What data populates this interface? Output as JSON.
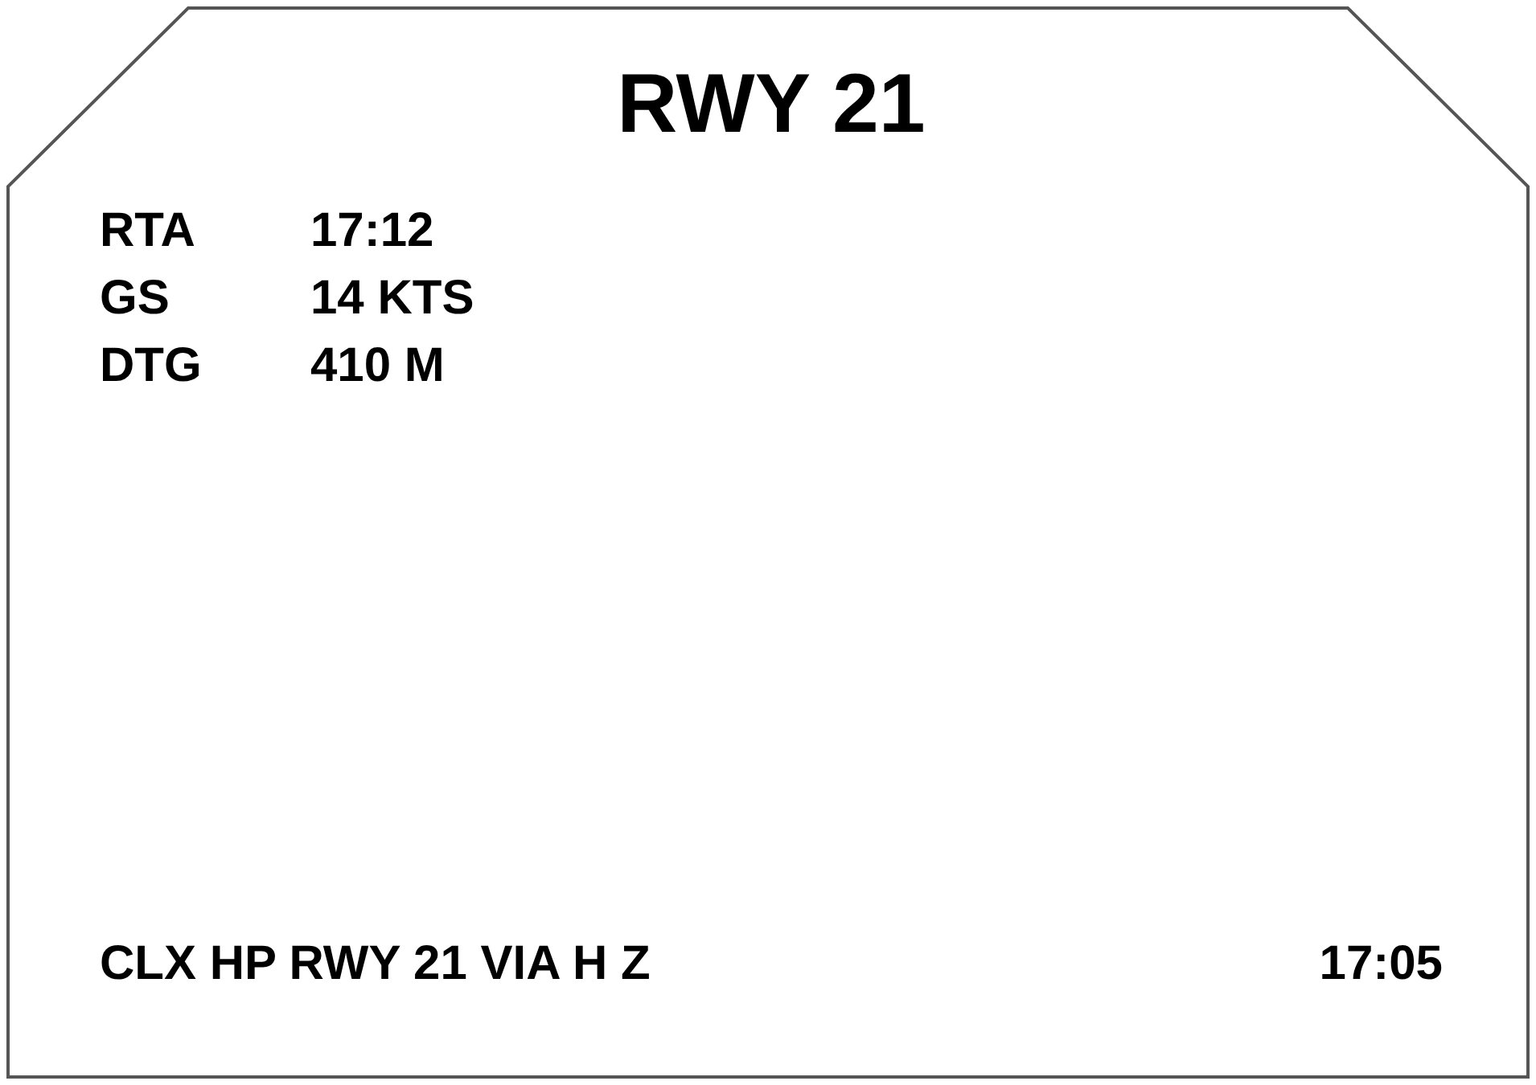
{
  "title": "RWY 21",
  "fields": [
    {
      "label": "RTA",
      "value": "17:12"
    },
    {
      "label": "GS",
      "value": "14 KTS"
    },
    {
      "label": "DTG",
      "value": "410 M"
    }
  ],
  "message": "CLX HP RWY 21 VIA H Z",
  "time": "17:05"
}
